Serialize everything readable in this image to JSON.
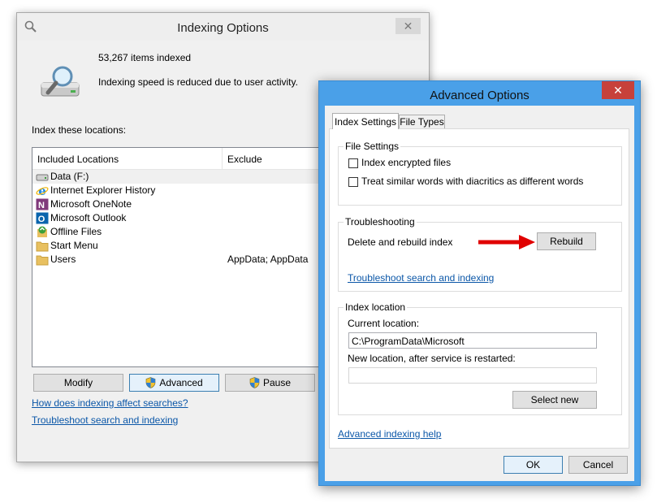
{
  "indexing_window": {
    "title": "Indexing Options",
    "items_indexed": "53,267 items indexed",
    "status": "Indexing speed is reduced due to user activity.",
    "locations_label": "Index these locations:",
    "columns": [
      "Included Locations",
      "Exclude"
    ],
    "locations": [
      {
        "name": "Data (F:)",
        "exclude": "",
        "icon": "drive-icon"
      },
      {
        "name": "Internet Explorer History",
        "exclude": "",
        "icon": "internet-explorer-icon"
      },
      {
        "name": "Microsoft OneNote",
        "exclude": "",
        "icon": "onenote-icon"
      },
      {
        "name": "Microsoft Outlook",
        "exclude": "",
        "icon": "outlook-icon"
      },
      {
        "name": "Offline Files",
        "exclude": "",
        "icon": "offline-files-icon"
      },
      {
        "name": "Start Menu",
        "exclude": "",
        "icon": "folder-icon"
      },
      {
        "name": "Users",
        "exclude": "AppData; AppData",
        "icon": "folder-icon"
      }
    ],
    "buttons": {
      "modify": "Modify",
      "advanced": "Advanced",
      "pause": "Pause"
    },
    "links": {
      "how_affects": "How does indexing affect searches?",
      "troubleshoot": "Troubleshoot search and indexing"
    },
    "close_glyph": "✕"
  },
  "advanced_window": {
    "title": "Advanced Options",
    "close_glyph": "✕",
    "tabs": [
      {
        "label": "Index Settings",
        "active": true
      },
      {
        "label": "File Types",
        "active": false
      }
    ],
    "file_settings": {
      "label": "File Settings",
      "index_encrypted": "Index encrypted files",
      "diacritics": "Treat similar words with diacritics as different words"
    },
    "troubleshooting": {
      "label": "Troubleshooting",
      "delete_rebuild": "Delete and rebuild index",
      "rebuild_button": "Rebuild",
      "link": "Troubleshoot search and indexing"
    },
    "index_location": {
      "label": "Index location",
      "current_label": "Current location:",
      "current_value": "C:\\ProgramData\\Microsoft",
      "new_label": "New location, after service is restarted:",
      "new_value": "",
      "select_new": "Select new"
    },
    "help_link": "Advanced indexing help",
    "ok": "OK",
    "cancel": "Cancel"
  },
  "colors": {
    "link": "#0b57a8",
    "accent_border": "#4aa0e8",
    "close_red": "#c7413b",
    "arrow_red": "#e00000"
  }
}
